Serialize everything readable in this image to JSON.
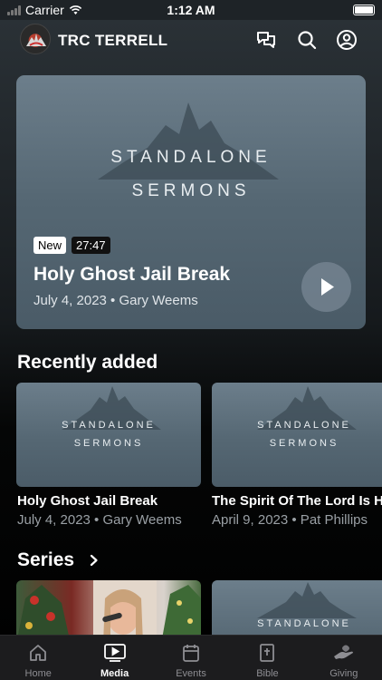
{
  "status_bar": {
    "carrier": "Carrier",
    "time": "1:12 AM"
  },
  "header": {
    "app_title": "TRC TERRELL",
    "icons": [
      "messages-icon",
      "search-icon",
      "profile-icon"
    ]
  },
  "hero": {
    "brand_line1": "STANDALONE",
    "brand_line2": "SERMONS",
    "badge": "New",
    "duration": "27:47",
    "title": "Holy Ghost Jail Break",
    "meta": "July 4, 2023 • Gary Weems"
  },
  "recently_added": {
    "title": "Recently added",
    "items": [
      {
        "brand1": "STANDALONE",
        "brand2": "SERMONS",
        "title": "Holy Ghost Jail Break",
        "meta": "July 4, 2023 • Gary Weems"
      },
      {
        "brand1": "STANDALONE",
        "brand2": "SERMONS",
        "title": "The Spirit Of The Lord Is He",
        "meta": "April 9, 2023 • Pat Phillips"
      }
    ]
  },
  "series": {
    "title": "Series",
    "items": [
      {
        "brand1": ""
      },
      {
        "brand1": "STANDALONE"
      }
    ]
  },
  "tabbar": {
    "items": [
      {
        "label": "Home",
        "active": false
      },
      {
        "label": "Media",
        "active": true
      },
      {
        "label": "Events",
        "active": false
      },
      {
        "label": "Bible",
        "active": false
      },
      {
        "label": "Giving",
        "active": false
      }
    ]
  },
  "colors": {
    "background": "#000000",
    "card_slate": "#5a6b77",
    "tab_bar": "#1c1c1e",
    "muted_text": "#9aa0a5"
  }
}
